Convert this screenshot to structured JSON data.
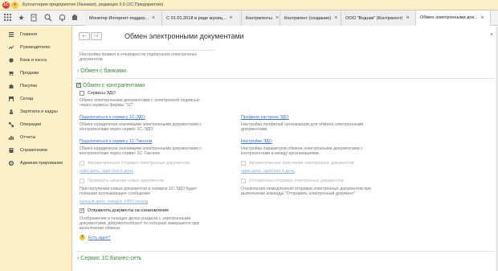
{
  "app": {
    "logo_text": "1С",
    "title": "Бухгалтерия предприятия (базовая), редакция 3.0 (1С:Предприятие)"
  },
  "toolbar": {
    "icons": [
      "apps-grid-icon",
      "star-icon",
      "history-icon",
      "search-icon",
      "bell-icon",
      "home-icon"
    ]
  },
  "tabs": [
    {
      "label": "Монитор Интернет-поддер...",
      "active": false
    },
    {
      "label": "С 01.01.2018 в ряде муниц...",
      "active": false
    },
    {
      "label": "Контрагенты",
      "active": false
    },
    {
      "label": "Контрагент (создание)",
      "active": false
    },
    {
      "label": "ООО \"Водник\" (Контрагент)",
      "active": false
    },
    {
      "label": "Обмен электронными док...",
      "active": true
    }
  ],
  "sidebar": {
    "items": [
      {
        "label": "Главное",
        "icon": "menu-lines-icon"
      },
      {
        "label": "Руководителю",
        "icon": "trend-icon"
      },
      {
        "label": "Банк и касса",
        "icon": "coins-icon"
      },
      {
        "label": "Продажи",
        "icon": "cart-icon"
      },
      {
        "label": "Покупки",
        "icon": "bag-icon"
      },
      {
        "label": "Склад",
        "icon": "warehouse-icon"
      },
      {
        "label": "Зарплата и кадры",
        "icon": "people-icon"
      },
      {
        "label": "Операции",
        "icon": "operations-icon"
      },
      {
        "label": "Отчеты",
        "icon": "report-icon"
      },
      {
        "label": "Справочники",
        "icon": "book-icon"
      },
      {
        "label": "Администрирование",
        "icon": "gear-icon"
      }
    ]
  },
  "form": {
    "back_glyph": "←",
    "forward_glyph": "→",
    "title": "Обмен электронными документами",
    "close_glyph": "×",
    "intro_line1": "Настройка правил и очередности подписания электронных",
    "intro_line2": "документов",
    "banks_section": "Обмен с банками",
    "counterparties_section": "Обмен с контрагентами",
    "edo_services": {
      "label": "Сервисы ЭДО",
      "checked": false,
      "desc1": "Обмен электронными документами с электронной подписью",
      "desc2": "через сервисы фирмы \"1С\""
    },
    "left": {
      "link1": "Подключиться к сервису 1С-ЭДО",
      "desc1_1": "Обмен юридически значимыми электронными документами с",
      "desc1_2": "контрагентами через сервис 1С-ЭДО",
      "link2": "Подключиться к сервису 1С-Такском",
      "desc2_1": "Обмен юридически значимыми электронными документами с",
      "desc2_2": "контрагентами через сервис 1С-Такском",
      "auto_send": "Автоматическая отправка электронных документов",
      "auto_send_sched": "один день; один раз в день",
      "check_new": "Проверять наличие новых документов",
      "check_new_desc1": "При получении новых документов в сервисе 1С-ЭДО будет",
      "check_new_desc2": "показано всплывающее сообщение",
      "check_new_sched": "каждый день; каждые 1800 секунд",
      "send_for_review": "Отправлять документы на ознакомление",
      "send_for_review_checked": true,
      "review_desc1": "Отображение в текущих делах раздела с электронными",
      "review_desc2": "документами, документооборот по которым завершится при",
      "review_desc3": "выполнении обмена",
      "idea_link": "Есть идея?"
    },
    "right": {
      "link1": "Профили настроек ЭДО",
      "desc1_1": "Настройка профилей организации для обмена электронными",
      "desc1_2": "документами",
      "link2": "Настройки ЭДО",
      "desc2_1": "Настройка параметров обмена электронными документами с",
      "desc2_2": "контрагентами и между организациями.",
      "auto_receive": "Автоматическое получение электронных документов",
      "auto_receive_sched": "один день; один раз в день",
      "deferred_send": "Отложенная отправка электронных документов",
      "deferred_desc1": "Отключение немедленной отправки электронных документов при",
      "deferred_desc2": "выполнении команды \"Отправить электронный документ\""
    },
    "business_net_section": "Сервис 1С:Бизнес-сеть"
  },
  "colors": {
    "sidebar_bg": "#fbf0c8",
    "section_green": "#3e8a3e",
    "link_blue": "#3f75b5"
  }
}
